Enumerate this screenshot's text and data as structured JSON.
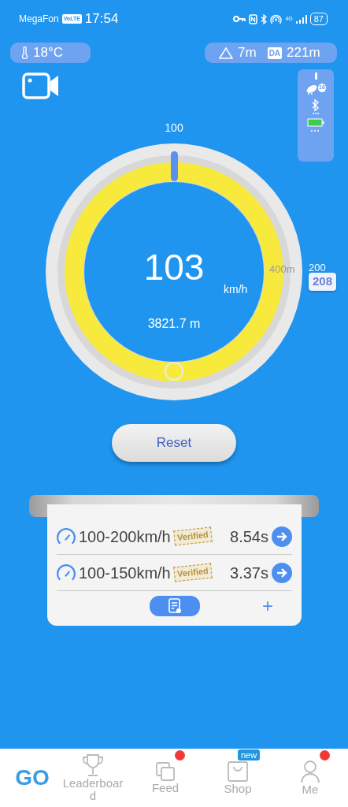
{
  "status_bar": {
    "carrier": "MegaFon",
    "volte": "VoLTE",
    "time": "17:54",
    "network": "4G",
    "battery": "87"
  },
  "chips": {
    "temperature": "18°C",
    "altitude": "7m",
    "da_label": "DA",
    "density_altitude": "221m"
  },
  "sensor_panel": {
    "satellites": "16"
  },
  "gauge": {
    "top_label": "100",
    "speed": "103",
    "unit": "km/h",
    "distance": "3821.7 m",
    "side_label": "400m",
    "right_label": "200",
    "badge": "208"
  },
  "reset_button": "Reset",
  "results": [
    {
      "range": "100-200km/h",
      "stamp": "Verified",
      "time": "8.54s"
    },
    {
      "range": "100-150km/h",
      "stamp": "Verified",
      "time": "3.37s"
    }
  ],
  "add_button": "+",
  "nav": [
    {
      "label": "GO",
      "kind": "text",
      "selected": true,
      "dot": false
    },
    {
      "label": "Leaderboard",
      "kind": "trophy",
      "selected": false,
      "dot": false
    },
    {
      "label": "Feed",
      "kind": "cards",
      "selected": false,
      "dot": true
    },
    {
      "label": "Shop",
      "kind": "bag",
      "selected": false,
      "dot": false,
      "badge": "new"
    },
    {
      "label": "Me",
      "kind": "person",
      "selected": false,
      "dot": true
    }
  ]
}
